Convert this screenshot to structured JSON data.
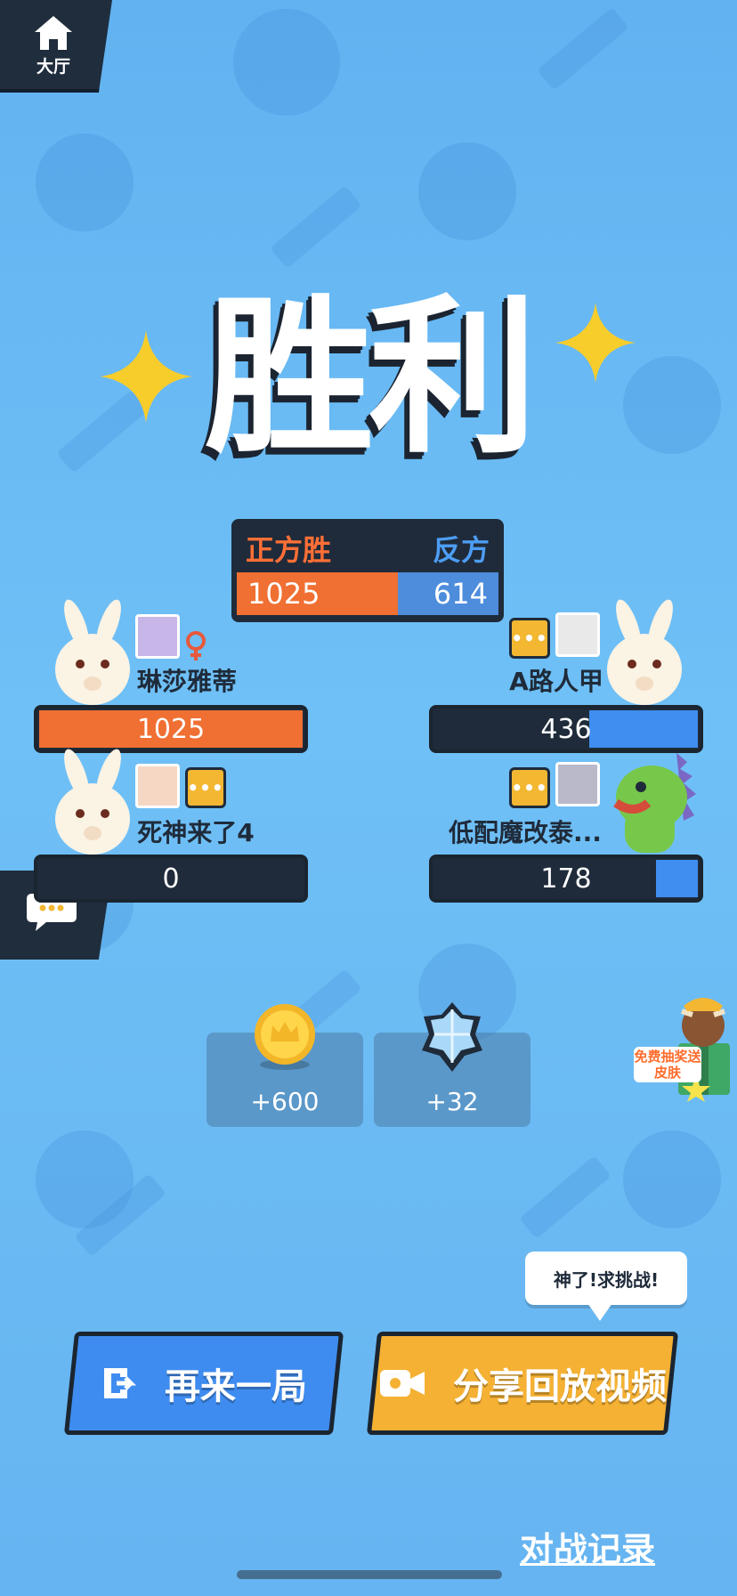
{
  "header": {
    "home_label": "大厅"
  },
  "result": {
    "title": "胜利"
  },
  "score": {
    "pro_label": "正方胜",
    "con_label": "反方",
    "pro_value": "1025",
    "con_value": "614"
  },
  "players": [
    {
      "name": "琳莎雅蒂",
      "score": "1025",
      "side": "pro",
      "gender": "♀",
      "fill_fraction": 1.0
    },
    {
      "name": "死神来了4",
      "score": "0",
      "side": "pro",
      "fill_fraction": 0.0
    },
    {
      "name": "A路人甲",
      "score": "436",
      "side": "con",
      "fill_fraction": 0.42
    },
    {
      "name": "低配魔改泰...",
      "score": "178",
      "side": "con",
      "fill_fraction": 0.17
    }
  ],
  "tag_text": "•••",
  "rewards": {
    "coins": "+600",
    "gems": "+32"
  },
  "promo": {
    "label": "免费抽奖送皮肤"
  },
  "bubble": {
    "text": "神了!求挑战!"
  },
  "buttons": {
    "replay_label": "再来一局",
    "share_label": "分享回放视频"
  },
  "footer": {
    "record_link": "对战记录"
  },
  "colors": {
    "pro": "#f06f32",
    "con": "#4e8cdc",
    "panel": "#1f2b3a",
    "share_button": "#f5b134",
    "replay_button": "#3f8cf0"
  }
}
